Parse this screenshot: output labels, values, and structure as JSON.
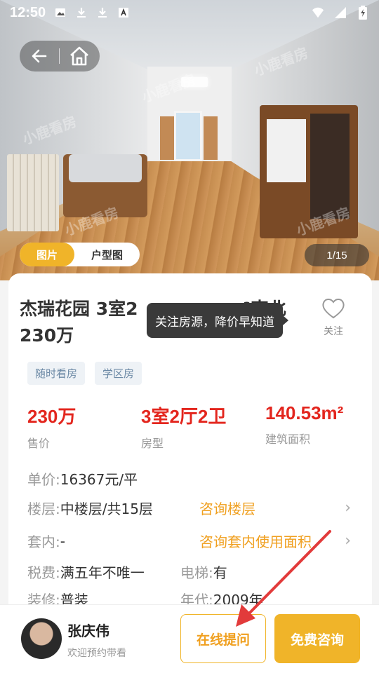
{
  "status_bar": {
    "time": "12:50",
    "icons": [
      "image-icon",
      "download-icon",
      "download-icon",
      "keyboard-icon"
    ],
    "right_icons": [
      "wifi-icon",
      "signal-icon",
      "battery-charging-icon"
    ]
  },
  "hero": {
    "watermark": "小鹿看房",
    "media_tabs": [
      {
        "label": "图片",
        "active": true
      },
      {
        "label": "户型图",
        "active": false
      }
    ],
    "counter": "1/15"
  },
  "listing": {
    "title_visible": "杰瑞花园 3室2",
    "title_tail": "²南北",
    "title_line2": "230万",
    "favorite_label": "关注",
    "tooltip": "关注房源，降价早知道",
    "tags": [
      "随时看房",
      "学区房"
    ],
    "stats": [
      {
        "value": "230万",
        "label": "售价"
      },
      {
        "value": "3室2厅2卫",
        "label": "房型"
      },
      {
        "value": "140.53m²",
        "label": "建筑面积"
      }
    ],
    "unit_price": {
      "key": "单价:",
      "value": "16367元/平"
    },
    "floor": {
      "key": "楼层:",
      "value": "中楼层/共15层",
      "link": "咨询楼层"
    },
    "inner": {
      "key": "套内:",
      "value": "-",
      "link": "咨询套内使用面积"
    },
    "tax": {
      "key": "税费:",
      "value": "满五年不唯一"
    },
    "elevator": {
      "key": "电梯:",
      "value": "有"
    },
    "decoration": {
      "key": "装修:",
      "value": "普装"
    },
    "year": {
      "key": "年代:",
      "value": "2009年"
    }
  },
  "agent": {
    "name": "张庆伟",
    "subtitle": "欢迎预约带看",
    "ask_button": "在线提问",
    "consult_button": "免费咨询"
  },
  "colors": {
    "accent": "#f0b429",
    "price_red": "#e3261e",
    "link_orange": "#f0a020",
    "annotation_red": "#e23b3b"
  }
}
